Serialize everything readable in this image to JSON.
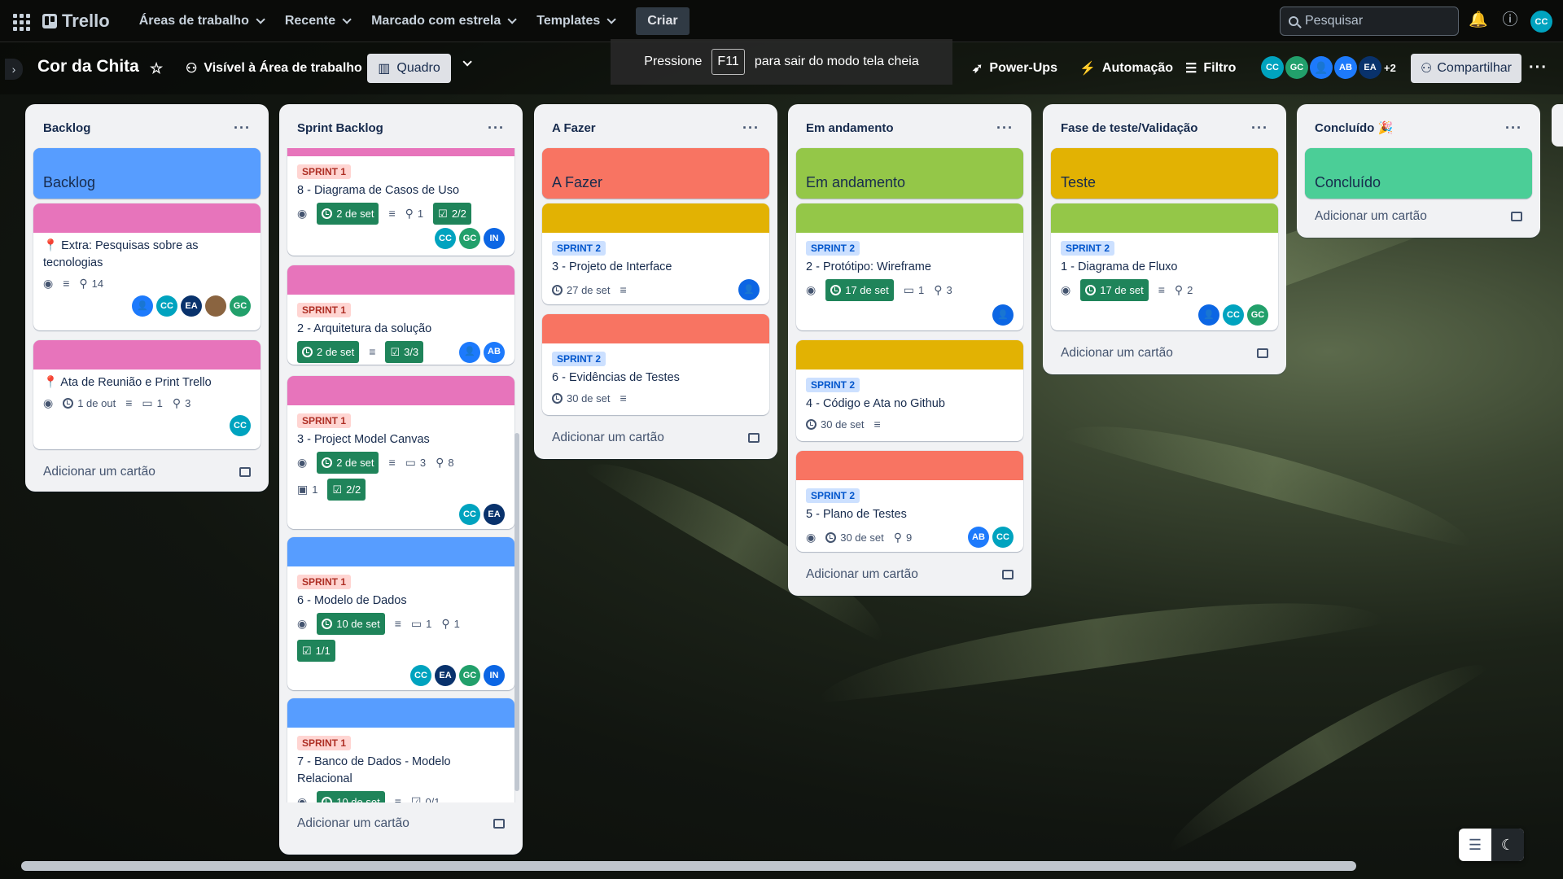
{
  "topbar": {
    "logo": "Trello",
    "nav": [
      "Áreas de trabalho",
      "Recente",
      "Marcado com estrela",
      "Templates"
    ],
    "create": "Criar",
    "search_placeholder": "Pesquisar",
    "user_initials": "CC"
  },
  "board": {
    "title": "Cor da Chita",
    "visibility": "Visível à Área de trabalho",
    "view": "Quadro",
    "powerups": "Power-Ups",
    "automation": "Automação",
    "filter": "Filtro",
    "members": [
      "CC",
      "GC",
      "",
      "AB",
      "EA"
    ],
    "members_more": "+2",
    "share": "Compartilhar"
  },
  "fullscreen_notice": {
    "before": "Pressione",
    "key": "F11",
    "after": "para sair do modo tela cheia"
  },
  "add_card_label": "Adicionar um cartão",
  "lists": [
    {
      "title": "Backlog",
      "header_card": "Backlog"
    },
    {
      "title": "Sprint Backlog"
    },
    {
      "title": "A Fazer",
      "header_card": "A Fazer"
    },
    {
      "title": "Em andamento",
      "header_card": "Em andamento"
    },
    {
      "title": "Fase de teste/Validação",
      "header_card": "Teste"
    },
    {
      "title": "Concluído 🎉",
      "header_card": "Concluído"
    }
  ],
  "cards": {
    "backlog1": {
      "title": "📍 Extra: Pesquisas sobre as tecnologias",
      "attachments": "14",
      "members": [
        "",
        "CC",
        "EA",
        "",
        "GC"
      ]
    },
    "backlog2": {
      "title": "📍 Ata de Reunião e Print Trello",
      "due": "1 de out",
      "comments": "1",
      "attachments": "3",
      "members": [
        "CC"
      ]
    },
    "sb1": {
      "label": "SPRINT 1",
      "title": "8 - Diagrama de Casos de Uso",
      "due": "2 de set",
      "attachments": "1",
      "checklist": "2/2",
      "members": [
        "CC",
        "GC",
        "IN"
      ]
    },
    "sb2": {
      "label": "SPRINT 1",
      "title": "2 - Arquitetura da solução",
      "due": "2 de set",
      "checklist": "3/3",
      "members": [
        "",
        "AB"
      ]
    },
    "sb3": {
      "label": "SPRINT 1",
      "title": "3 - Project Model Canvas",
      "due": "2 de set",
      "comments": "3",
      "attachments": "8",
      "trello_cards": "1",
      "checklist": "2/2",
      "members": [
        "CC",
        "EA"
      ]
    },
    "sb4": {
      "label": "SPRINT 1",
      "title": "6 - Modelo de Dados",
      "due": "10 de set",
      "comments": "1",
      "attachments": "1",
      "checklist": "1/1",
      "members": [
        "CC",
        "EA",
        "GC",
        "IN"
      ]
    },
    "sb5": {
      "label": "SPRINT 1",
      "title": "7 - Banco de Dados - Modelo Relacional",
      "due": "10 de set",
      "checklist": "0/1"
    },
    "af1": {
      "label": "SPRINT 2",
      "title": "3 - Projeto de Interface",
      "due": "27 de set",
      "members": [
        ""
      ]
    },
    "af2": {
      "label": "SPRINT 2",
      "title": "6 - Evidências de Testes",
      "due": "30 de set"
    },
    "ea1": {
      "label": "SPRINT 2",
      "title": "2 - Protótipo: Wireframe",
      "due": "17 de set",
      "comments": "1",
      "attachments": "3",
      "members": [
        ""
      ]
    },
    "ea2": {
      "label": "SPRINT 2",
      "title": "4 - Código e Ata no Github",
      "due": "30 de set"
    },
    "ea3": {
      "label": "SPRINT 2",
      "title": "5 - Plano de Testes",
      "due": "30 de set",
      "attachments": "9",
      "members": [
        "AB",
        "CC"
      ]
    },
    "ft1": {
      "label": "SPRINT 2",
      "title": "1 - Diagrama de Fluxo",
      "due": "17 de set",
      "attachments": "2",
      "members": [
        "",
        "CC",
        "GC"
      ]
    }
  },
  "colors": {
    "blue": "#579dff",
    "pink": "#e774bb",
    "orange": "#f87462",
    "yellow": "#e2b203",
    "lime": "#94c748",
    "green": "#4bce97",
    "due_green": "#1f845a"
  }
}
